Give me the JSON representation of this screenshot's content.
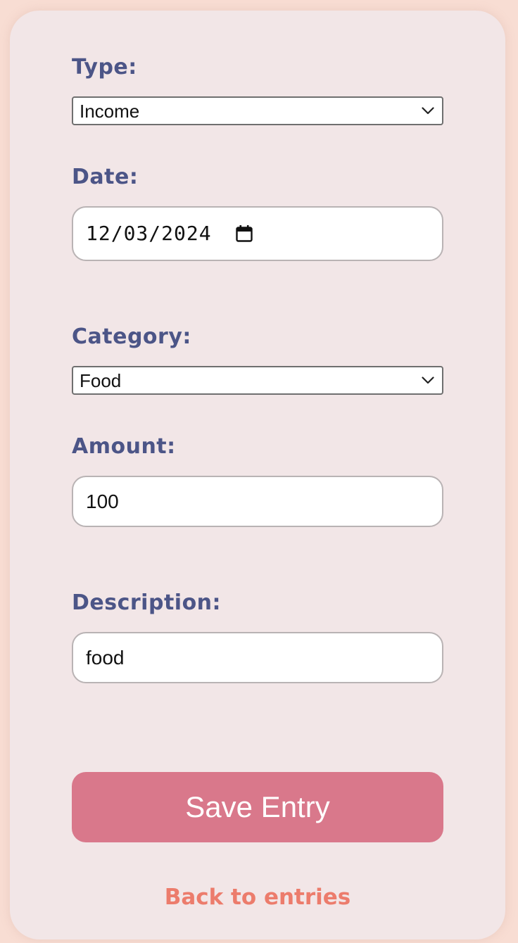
{
  "form": {
    "type": {
      "label": "Type:",
      "value": "Income"
    },
    "date": {
      "label": "Date:",
      "value": "12/03/2024"
    },
    "category": {
      "label": "Category:",
      "value": "Food"
    },
    "amount": {
      "label": "Amount:",
      "value": "100"
    },
    "description": {
      "label": "Description:",
      "value": "food"
    },
    "save_label": "Save Entry",
    "back_label": "Back to entries"
  },
  "icons": {
    "select": "chevron-down-icon",
    "date": "calendar-icon"
  },
  "colors": {
    "page_background": "#f8ddd3",
    "card_background": "#f2e6e7",
    "label": "#4c5587",
    "save_button": "#d9788b",
    "back_link": "#ec7c6c"
  }
}
